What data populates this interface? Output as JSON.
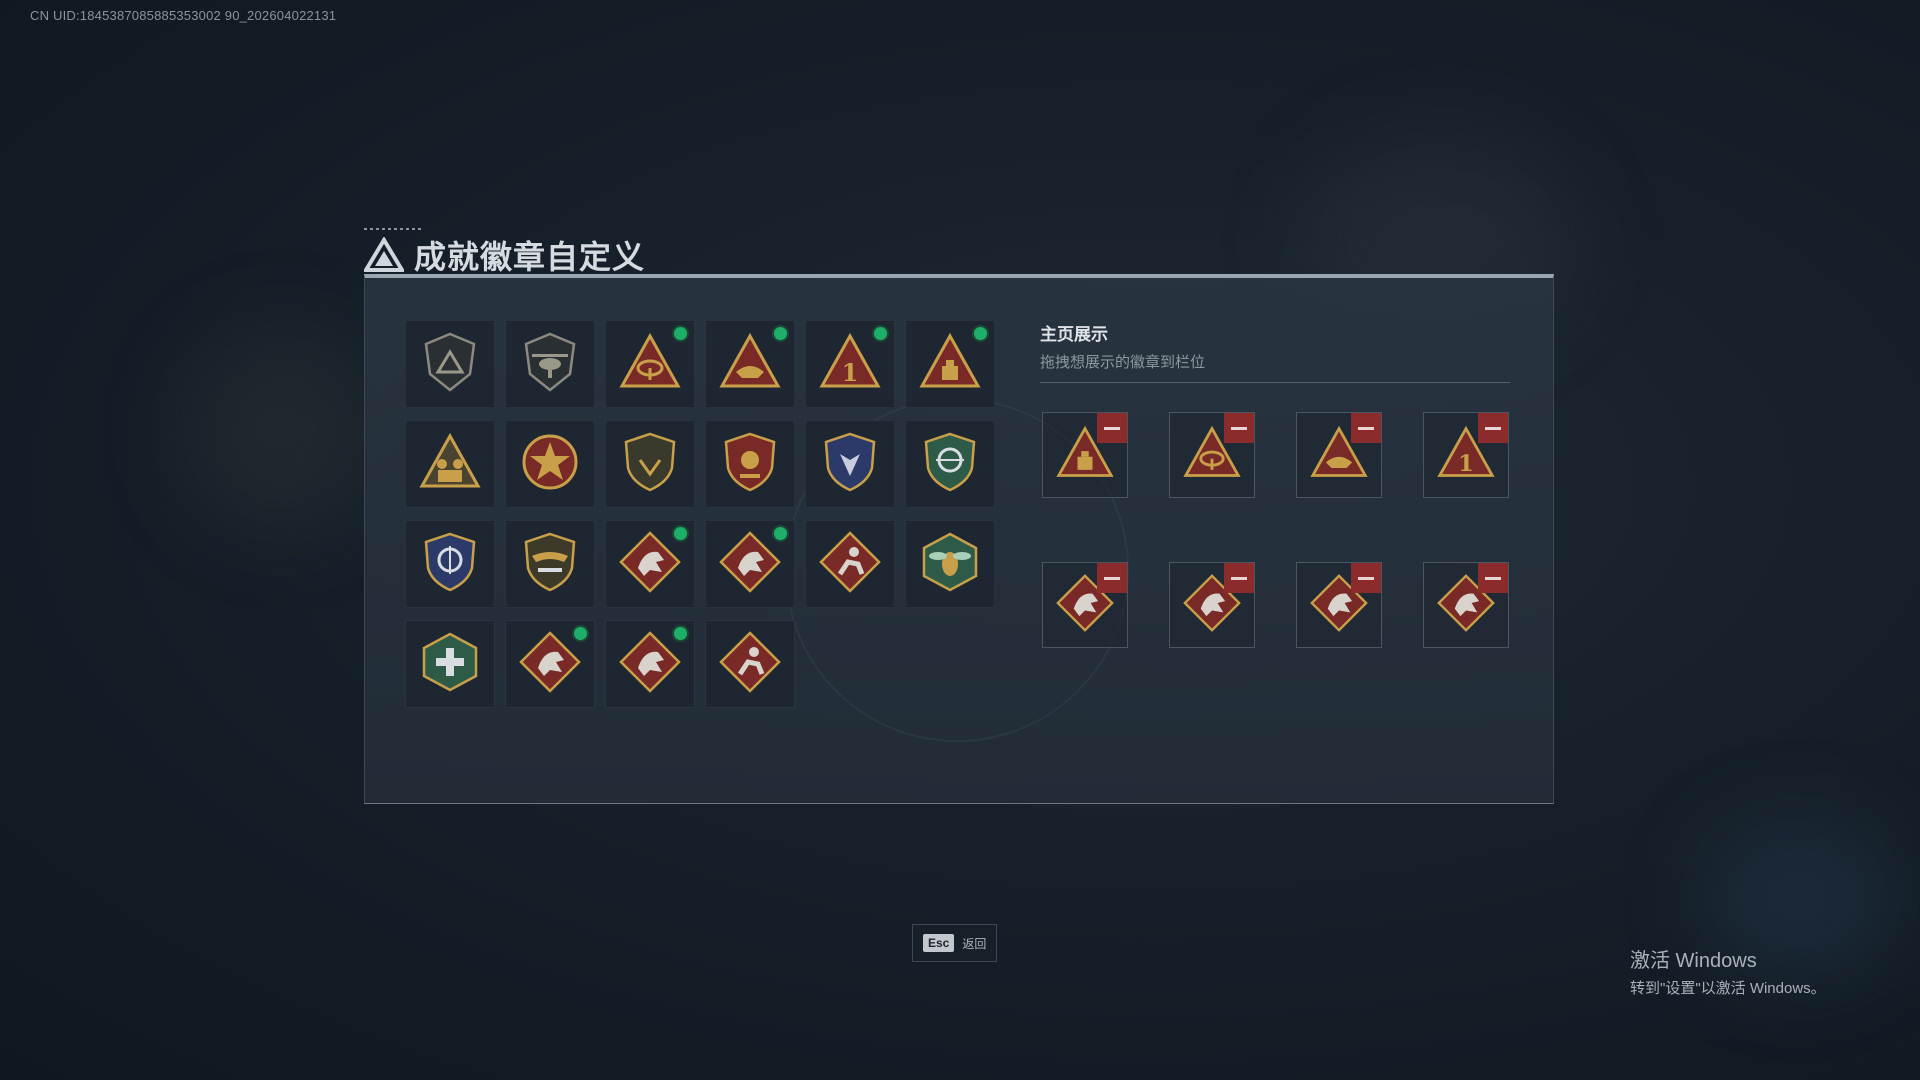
{
  "uid_text": "CN UID:1845387085885353002 90_202604022131",
  "title": "成就徽章自定义",
  "display": {
    "title": "主页展示",
    "subtitle": "拖拽想展示的徽章到栏位"
  },
  "badges": [
    {
      "icon": "shield-triangle-icon",
      "new": false
    },
    {
      "icon": "helicopter-icon",
      "new": false
    },
    {
      "icon": "satellite-dish-icon",
      "new": true
    },
    {
      "icon": "boat-icon",
      "new": true
    },
    {
      "icon": "number-one-icon",
      "new": true
    },
    {
      "icon": "supply-crate-icon",
      "new": true
    },
    {
      "icon": "squad-icon",
      "new": false
    },
    {
      "icon": "star-medal-icon",
      "new": false
    },
    {
      "icon": "shield-wing-icon",
      "new": false
    },
    {
      "icon": "crest-icon",
      "new": false
    },
    {
      "icon": "wolf-shield-icon",
      "new": false
    },
    {
      "icon": "crosshair-shield-icon",
      "new": false
    },
    {
      "icon": "scope-shield-icon",
      "new": false
    },
    {
      "icon": "winged-rifle-icon",
      "new": false
    },
    {
      "icon": "dragon-icon",
      "new": true
    },
    {
      "icon": "dragon-icon",
      "new": true
    },
    {
      "icon": "runner-icon",
      "new": false
    },
    {
      "icon": "hornet-icon",
      "new": false
    },
    {
      "icon": "medic-icon",
      "new": false
    },
    {
      "icon": "dragon-icon",
      "new": true
    },
    {
      "icon": "dragon-icon",
      "new": true
    },
    {
      "icon": "runner-icon",
      "new": false
    }
  ],
  "slots": [
    {
      "icon": "supply-crate-icon"
    },
    {
      "icon": "satellite-dish-icon"
    },
    {
      "icon": "boat-icon"
    },
    {
      "icon": "number-one-icon"
    },
    {
      "icon": "dragon-icon"
    },
    {
      "icon": "dragon-icon"
    },
    {
      "icon": "dragon-icon"
    },
    {
      "icon": "dragon-icon"
    }
  ],
  "esc": {
    "key": "Esc",
    "label": "返回"
  },
  "windows": {
    "line1": "激活 Windows",
    "line2": "转到\"设置\"以激活 Windows。"
  },
  "colors": {
    "accent_green": "#1fae6a",
    "remove_red": "#8c2b2b",
    "gold": "#c9a04a",
    "badge_red": "#7a2a26"
  }
}
